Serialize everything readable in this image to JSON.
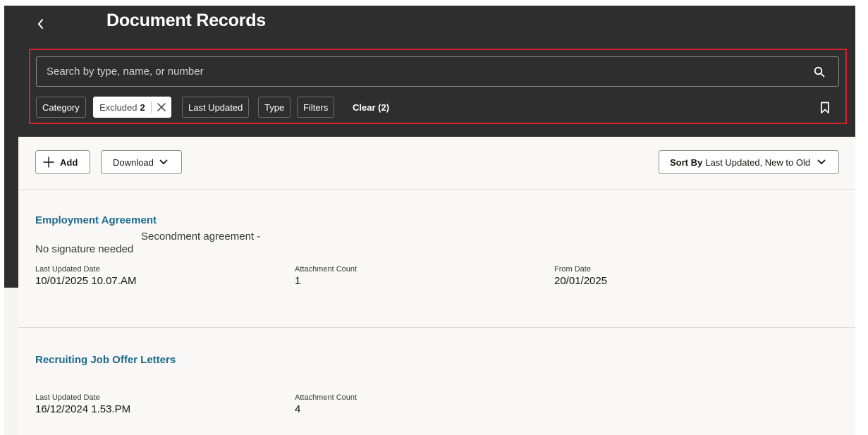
{
  "header": {
    "title": "Document Records",
    "back_icon": "chevron-left-icon"
  },
  "search": {
    "placeholder": "Search by type, name, or number",
    "icon": "search-icon"
  },
  "filters": {
    "chips": [
      {
        "label": "Category"
      },
      {
        "label": "Excluded",
        "count": "2"
      },
      {
        "label": "Last Updated"
      },
      {
        "label": "Type"
      },
      {
        "label": "Filters"
      }
    ],
    "clear_label": "Clear (2)",
    "bookmark_icon": "bookmark-icon"
  },
  "toolbar": {
    "add_label": "Add",
    "download_label": "Download",
    "sort_prefix": "Sort By",
    "sort_value": "Last Updated, New to Old"
  },
  "records": [
    {
      "title": "Employment Agreement",
      "description_line1": "Secondment agreement -",
      "description_line2": "No signature needed",
      "fields": [
        {
          "label": "Last Updated Date",
          "value": "10/01/2025 10.07.AM"
        },
        {
          "label": "Attachment Count",
          "value": "1"
        },
        {
          "label": "From Date",
          "value": "20/01/2025"
        }
      ]
    },
    {
      "title": "Recruiting Job Offer Letters",
      "fields": [
        {
          "label": "Last Updated Date",
          "value": "16/12/2024 1.53.PM"
        },
        {
          "label": "Attachment Count",
          "value": "4"
        }
      ]
    }
  ],
  "colors": {
    "header_bg": "#2e2e2e",
    "highlight_border": "#d3222a",
    "link": "#1d6a8a",
    "card_bg": "#f9f8f7"
  }
}
